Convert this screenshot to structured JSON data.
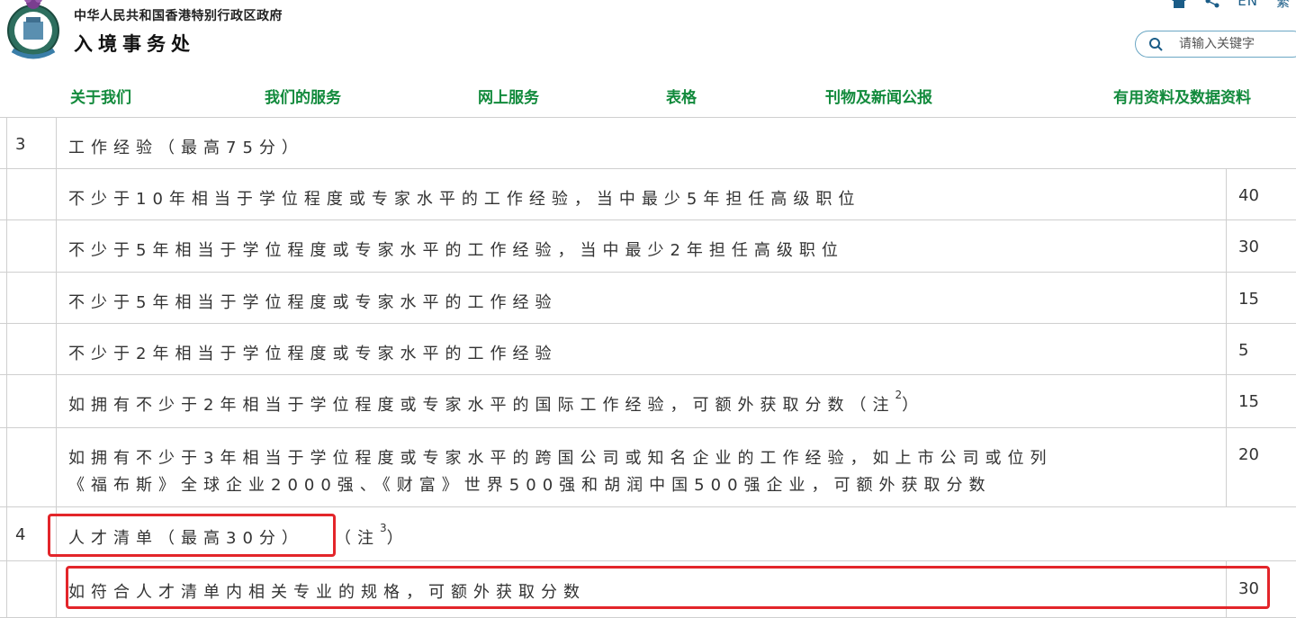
{
  "header": {
    "gov_name": "中华人民共和国香港特别行政区政府",
    "dept_name": "入境事务处",
    "lang_en": "EN",
    "lang_tc": "繁",
    "search_placeholder": "请输入关键字"
  },
  "nav": {
    "items": [
      "关于我们",
      "我们的服务",
      "网上服务",
      "表格",
      "刊物及新闻公报",
      "有用资料及数据资料"
    ]
  },
  "table": {
    "section3": {
      "num": "3",
      "title": "工作经验（最高75分）"
    },
    "rows3": [
      {
        "text": "不少于10年相当于学位程度或专家水平的工作经验，当中最少5年担任高级职位",
        "score": "40"
      },
      {
        "text": "不少于5年相当于学位程度或专家水平的工作经验，当中最少2年担任高级职位",
        "score": "30"
      },
      {
        "text": "不少于5年相当于学位程度或专家水平的工作经验",
        "score": "15"
      },
      {
        "text": "不少于2年相当于学位程度或专家水平的工作经验",
        "score": "5"
      },
      {
        "text": "如拥有不少于2年相当于学位程度或专家水平的国际工作经验，可额外获取分数（注",
        "note": "2",
        "tail": "）",
        "score": "15"
      },
      {
        "line1": "如拥有不少于3年相当于学位程度或专家水平的跨国公司或知名企业的工作经验，如上市公司或位列",
        "line2": "《福布斯》全球企业2000强、《财富》世界500强和胡润中国500强企业，可额外获取分数",
        "score": "20"
      }
    ],
    "section4": {
      "num": "4",
      "title": "人才清单（最高30分）",
      "note_prefix": "（注",
      "note": "3",
      "note_suffix": "）"
    },
    "rows4": [
      {
        "text": "如符合人才清单内相关专业的规格，可额外获取分数",
        "score": "30"
      }
    ]
  },
  "colors": {
    "nav_green": "#128a3c",
    "link_blue": "#1a5c87",
    "highlight_red": "#e3252a"
  }
}
